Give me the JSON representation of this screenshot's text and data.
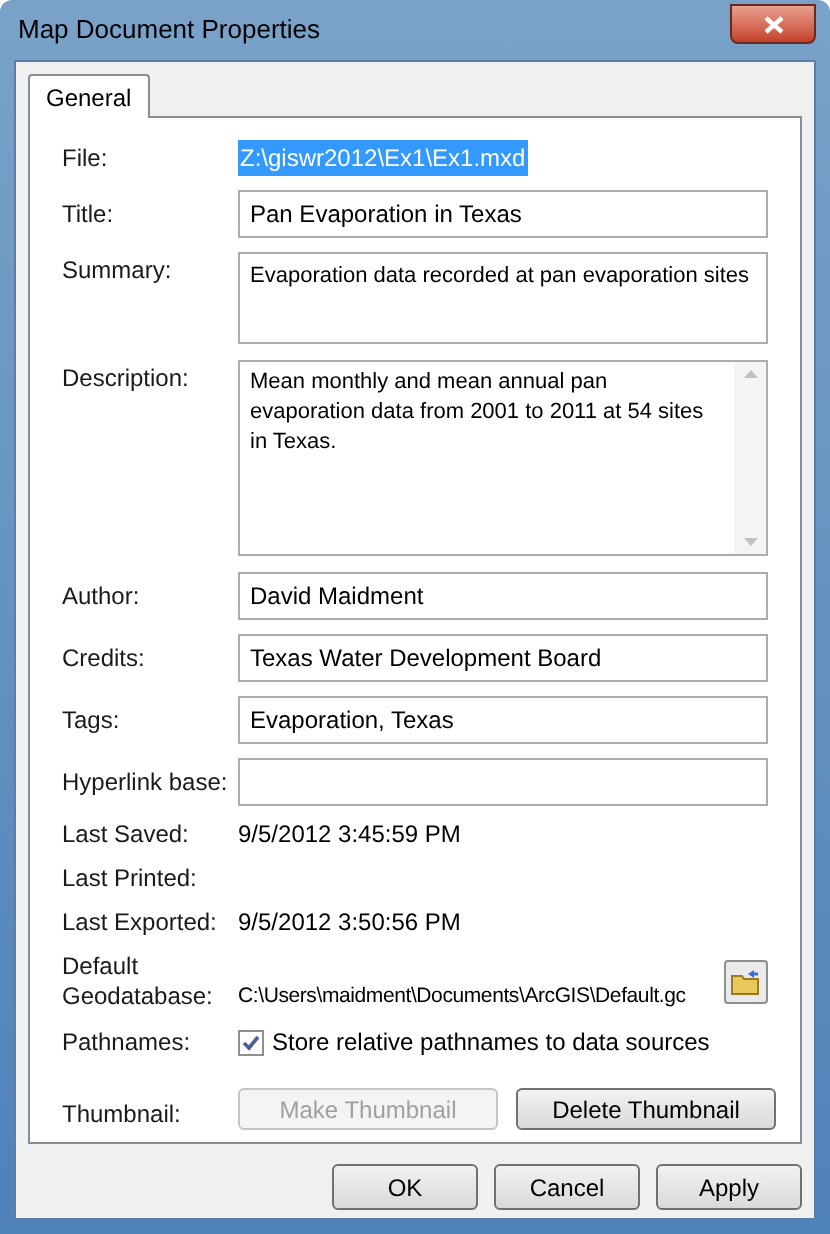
{
  "window": {
    "title": "Map Document Properties"
  },
  "tabs": [
    {
      "label": "General",
      "selected": true
    }
  ],
  "rows": [
    {
      "kind": "selected-text",
      "label": "File:",
      "value": "Z:\\giswr2012\\Ex1\\Ex1.mxd"
    },
    {
      "kind": "field",
      "label": "Title:",
      "value": "Pan Evaporation in Texas"
    },
    {
      "kind": "memo",
      "label": "Summary:",
      "value": "Evaporation data recorded at pan evaporation sites"
    },
    {
      "kind": "scroll-memo",
      "label": "Description:",
      "value": "Mean monthly and mean annual pan evaporation data from 2001 to 2011 at 54 sites in Texas."
    },
    {
      "kind": "field",
      "label": "Author:",
      "value": "David Maidment"
    },
    {
      "kind": "field",
      "label": "Credits:",
      "value": "Texas Water Development Board"
    },
    {
      "kind": "field",
      "label": "Tags:",
      "value": "Evaporation, Texas"
    },
    {
      "kind": "field",
      "label": "Hyperlink base:"
    },
    {
      "kind": "info",
      "label": "Last Saved:",
      "value": "9/5/2012 3:45:59 PM"
    },
    {
      "kind": "info",
      "label": "Last Printed:"
    },
    {
      "kind": "info",
      "label": "Last Exported:",
      "value": "9/5/2012 3:50:56 PM"
    },
    {
      "kind": "path",
      "label": "Default Geodatabase:",
      "value": "C:\\Users\\maidment\\Documents\\ArcGIS\\Default.gc"
    },
    {
      "kind": "checkbox",
      "label": "Pathnames:",
      "value": "Store relative pathnames to data sources",
      "checked": true
    },
    {
      "kind": "buttons",
      "label": "Thumbnail:",
      "buttons": [
        {
          "label": "Make Thumbnail",
          "disabled": true
        },
        {
          "label": "Delete Thumbnail",
          "disabled": false
        }
      ]
    }
  ],
  "buttons": [
    "OK",
    "Cancel",
    "Apply"
  ]
}
